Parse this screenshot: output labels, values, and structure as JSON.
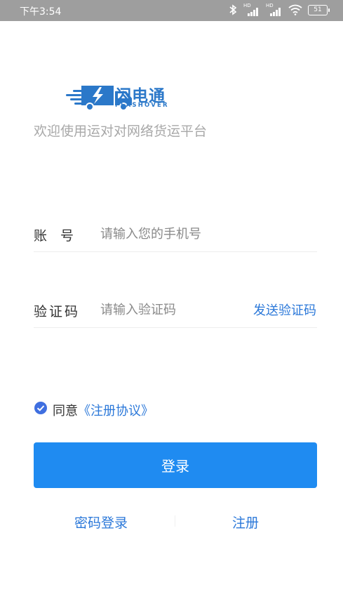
{
  "status_bar": {
    "time": "下午3:54",
    "battery": "51",
    "signal_badge": "HD"
  },
  "brand": {
    "name": "闪电通",
    "subtitle": "FLASHOVER",
    "accent_color": "#2b78c9"
  },
  "welcome_text": "欢迎使用运对对网络货运平台",
  "form": {
    "account_label": "账　号",
    "account_placeholder": "请输入您的手机号",
    "code_label": "验证码",
    "code_placeholder": "请输入验证码",
    "send_code_label": "发送验证码"
  },
  "agreement": {
    "checked": true,
    "prefix": "同意",
    "link_text": "《注册协议》"
  },
  "login_button_label": "登录",
  "bottom_links": {
    "password_login": "密码登录",
    "register": "注册"
  },
  "colors": {
    "primary_button": "#1f8bf1",
    "link": "#2b78d9",
    "status_bar": "#9e9e9e"
  }
}
